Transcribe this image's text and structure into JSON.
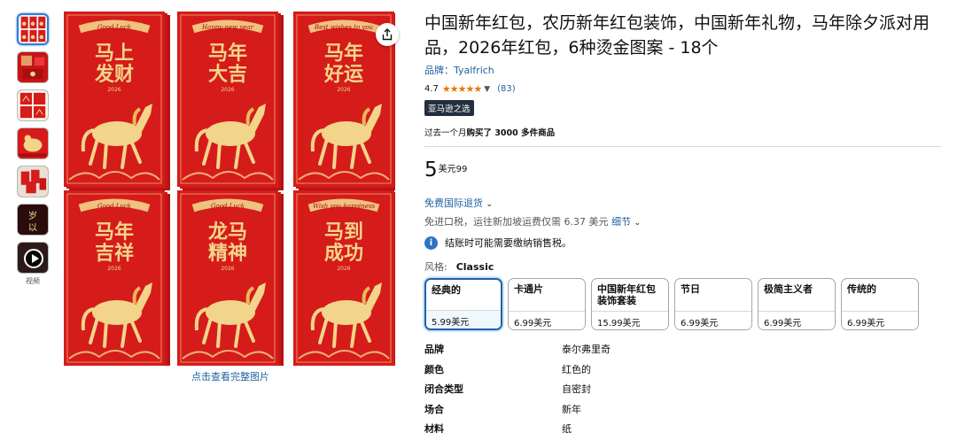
{
  "thumbnails": [
    {
      "icon": "red-envelope-set-thumbnail",
      "active": true
    },
    {
      "icon": "red-envelope-pack-thumbnail",
      "active": false
    },
    {
      "icon": "red-envelope-layout-thumbnail",
      "active": false
    },
    {
      "icon": "red-envelope-horse-thumbnail",
      "active": false
    },
    {
      "icon": "red-envelope-lifestyle-thumbnail",
      "active": false
    },
    {
      "icon": "red-envelope-calligraphy-thumbnail",
      "active": false
    }
  ],
  "video_label": "视频",
  "main_image": {
    "envelopes": [
      {
        "banner": "Good Luck",
        "text": "马上发财",
        "year": "2026"
      },
      {
        "banner": "Happy new year",
        "text": "马年大吉",
        "year": "2026"
      },
      {
        "banner": "Best wishes to you",
        "text": "马年好运",
        "year": "2026"
      },
      {
        "banner": "Good Luck",
        "text": "马年吉祥",
        "year": "2026"
      },
      {
        "banner": "Good Luck",
        "text": "龙马精神",
        "year": "2026"
      },
      {
        "banner": "Wish you happiness",
        "text": "马到成功",
        "year": "2026"
      }
    ]
  },
  "full_image_link": "点击查看完整图片",
  "title": "中国新年红包，农历新年红包装饰，中国新年礼物，马年除夕派对用品，2026年红包，6种烫金图案 - 18个",
  "brand_label": "品牌：Tyalfrich",
  "rating": {
    "value": "4.7",
    "stars": "★★★★★",
    "count": "(83)"
  },
  "badge": "亚马逊之选",
  "bought": {
    "prefix": "过去一个月",
    "bold": "购买了 3000 多件商品"
  },
  "price": {
    "whole": "5",
    "currency_fraction": "美元99"
  },
  "returns": "免费国际退货",
  "shipping": {
    "text": "免进口税，运往新加坡运费仅需 6.37 美元",
    "link": "细节"
  },
  "tax_note": "结账时可能需要缴纳销售税。",
  "style": {
    "label": "风格:",
    "selected": "Classic",
    "options": [
      {
        "name": "经典的",
        "price": "5.99美元"
      },
      {
        "name": "卡通片",
        "price": "6.99美元"
      },
      {
        "name": "中国新年红包装饰套装",
        "price": "15.99美元"
      },
      {
        "name": "节日",
        "price": "6.99美元"
      },
      {
        "name": "极简主义者",
        "price": "6.99美元"
      },
      {
        "name": "传统的",
        "price": "6.99美元"
      }
    ]
  },
  "attributes": [
    {
      "key": "品牌",
      "value": "泰尔弗里奇"
    },
    {
      "key": "颜色",
      "value": "红色的"
    },
    {
      "key": "闭合类型",
      "value": "自密封"
    },
    {
      "key": "场合",
      "value": "新年"
    },
    {
      "key": "材料",
      "value": "纸"
    }
  ],
  "colors": {
    "red": "#d61b1b",
    "gold": "#f2d58a",
    "link": "#2162a1",
    "badge": "#232f3e",
    "star": "#e77600"
  }
}
